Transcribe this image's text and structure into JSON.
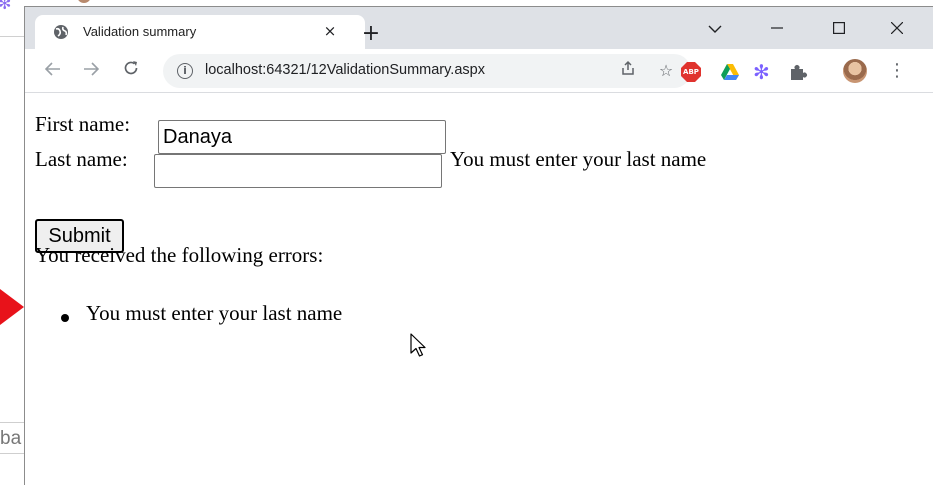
{
  "background_window": {
    "partial_text": "ba"
  },
  "browser": {
    "tab": {
      "title": "Validation summary",
      "close_glyph": "×"
    },
    "new_tab_glyph": "+",
    "window_controls": {
      "dropdown_glyph": "⌵",
      "minimize_glyph": "–",
      "maximize_glyph": "☐",
      "close_glyph": "✕"
    },
    "nav": {
      "back_glyph": "←",
      "forward_glyph": "→",
      "reload_glyph": "C"
    },
    "omnibox": {
      "url": "localhost:64321/12ValidationSummary.aspx",
      "info_glyph": "i",
      "share_glyph": "⇪",
      "bookmark_glyph": "☆"
    },
    "extensions": {
      "abp_label": "ABP",
      "menu_glyph": "⋮"
    }
  },
  "form": {
    "first_name_label": "First name:",
    "first_name_value": "Danaya",
    "last_name_label": "Last name:",
    "last_name_value": "",
    "last_name_error": "You must enter your last name",
    "submit_label": "Submit"
  },
  "summary": {
    "header": "You received the following errors:",
    "errors": [
      "You must enter your last name"
    ]
  },
  "colors": {
    "tabstrip_bg": "#dee1e6",
    "omnibox_bg": "#f1f3f4",
    "arrow_red": "#e8121a",
    "abp_red": "#e0332e"
  }
}
